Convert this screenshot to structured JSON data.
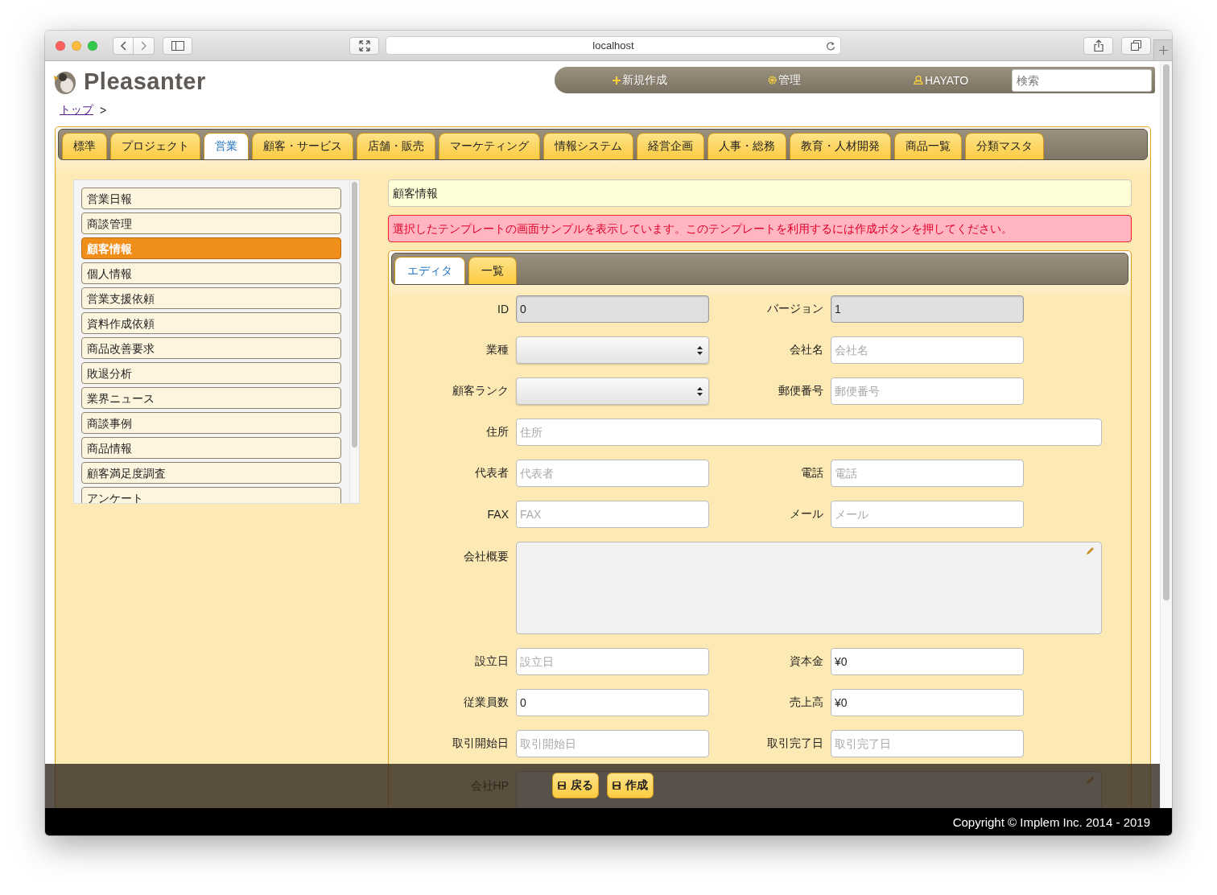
{
  "browser": {
    "url": "localhost"
  },
  "header": {
    "logo": "Pleasanter",
    "menu": [
      {
        "kind": "plus",
        "label": "新規作成"
      },
      {
        "kind": "gear",
        "label": "管理"
      },
      {
        "kind": "user",
        "label": "HAYATO"
      }
    ],
    "search": {
      "placeholder": "検索"
    }
  },
  "breadcrumb": {
    "links": [
      "トップ"
    ],
    "separator": ">"
  },
  "tabs": [
    {
      "label": "標準",
      "selected": false
    },
    {
      "label": "プロジェクト",
      "selected": false
    },
    {
      "label": "営業",
      "selected": true
    },
    {
      "label": "顧客・サービス",
      "selected": false
    },
    {
      "label": "店舗・販売",
      "selected": false
    },
    {
      "label": "マーケティング",
      "selected": false
    },
    {
      "label": "情報システム",
      "selected": false
    },
    {
      "label": "経営企画",
      "selected": false
    },
    {
      "label": "人事・総務",
      "selected": false
    },
    {
      "label": "教育・人材開発",
      "selected": false
    },
    {
      "label": "商品一覧",
      "selected": false
    },
    {
      "label": "分類マスタ",
      "selected": false
    }
  ],
  "sidebar": {
    "items": [
      {
        "label": "営業日報",
        "selected": false
      },
      {
        "label": "商談管理",
        "selected": false
      },
      {
        "label": "顧客情報",
        "selected": true
      },
      {
        "label": "個人情報",
        "selected": false
      },
      {
        "label": "営業支援依頼",
        "selected": false
      },
      {
        "label": "資料作成依頼",
        "selected": false
      },
      {
        "label": "商品改善要求",
        "selected": false
      },
      {
        "label": "敗退分析",
        "selected": false
      },
      {
        "label": "業界ニュース",
        "selected": false
      },
      {
        "label": "商談事例",
        "selected": false
      },
      {
        "label": "商品情報",
        "selected": false
      },
      {
        "label": "顧客満足度調査",
        "selected": false
      },
      {
        "label": "アンケート",
        "selected": false
      }
    ]
  },
  "title": "顧客情報",
  "message": "選択したテンプレートの画面サンプルを表示しています。このテンプレートを利用するには作成ボタンを押してください。",
  "editor_tabs": [
    {
      "label": "エディタ",
      "selected": true
    },
    {
      "label": "一覧",
      "selected": false
    }
  ],
  "fields": [
    {
      "kind": "text",
      "label": "ID",
      "value": "0",
      "readonly": true,
      "full": false
    },
    {
      "kind": "text",
      "label": "バージョン",
      "value": "1",
      "readonly": true,
      "full": false
    },
    {
      "kind": "select",
      "label": "業種",
      "readonly": false,
      "full": false
    },
    {
      "kind": "text",
      "label": "会社名",
      "placeholder": "会社名",
      "readonly": false,
      "full": false
    },
    {
      "kind": "select",
      "label": "顧客ランク",
      "readonly": false,
      "full": false
    },
    {
      "kind": "text",
      "label": "郵便番号",
      "placeholder": "郵便番号",
      "readonly": false,
      "full": false
    },
    {
      "kind": "text",
      "label": "住所",
      "placeholder": "住所",
      "readonly": false,
      "full": true
    },
    {
      "kind": "text",
      "label": "代表者",
      "placeholder": "代表者",
      "readonly": false,
      "full": false
    },
    {
      "kind": "text",
      "label": "電話",
      "placeholder": "電話",
      "readonly": false,
      "full": false
    },
    {
      "kind": "text",
      "label": "FAX",
      "placeholder": "FAX",
      "readonly": false,
      "full": false
    },
    {
      "kind": "text",
      "label": "メール",
      "placeholder": "メール",
      "readonly": false,
      "full": false
    },
    {
      "kind": "markdown",
      "label": "会社概要",
      "readonly": false,
      "full": true
    },
    {
      "kind": "text",
      "label": "設立日",
      "placeholder": "設立日",
      "readonly": false,
      "full": false
    },
    {
      "kind": "text",
      "label": "資本金",
      "value": "¥0",
      "readonly": false,
      "full": false
    },
    {
      "kind": "text",
      "label": "従業員数",
      "value": "0",
      "readonly": false,
      "full": false
    },
    {
      "kind": "text",
      "label": "売上高",
      "value": "¥0",
      "readonly": false,
      "full": false
    },
    {
      "kind": "text",
      "label": "取引開始日",
      "placeholder": "取引開始日",
      "readonly": false,
      "full": false
    },
    {
      "kind": "text",
      "label": "取引完了日",
      "placeholder": "取引完了日",
      "readonly": false,
      "full": false
    },
    {
      "kind": "markdown",
      "label": "会社HP",
      "readonly": false,
      "full": true
    }
  ],
  "actions": [
    {
      "label": "戻る"
    },
    {
      "label": "作成"
    }
  ],
  "footer": "Copyright © Implem Inc. 2014 - 2019"
}
